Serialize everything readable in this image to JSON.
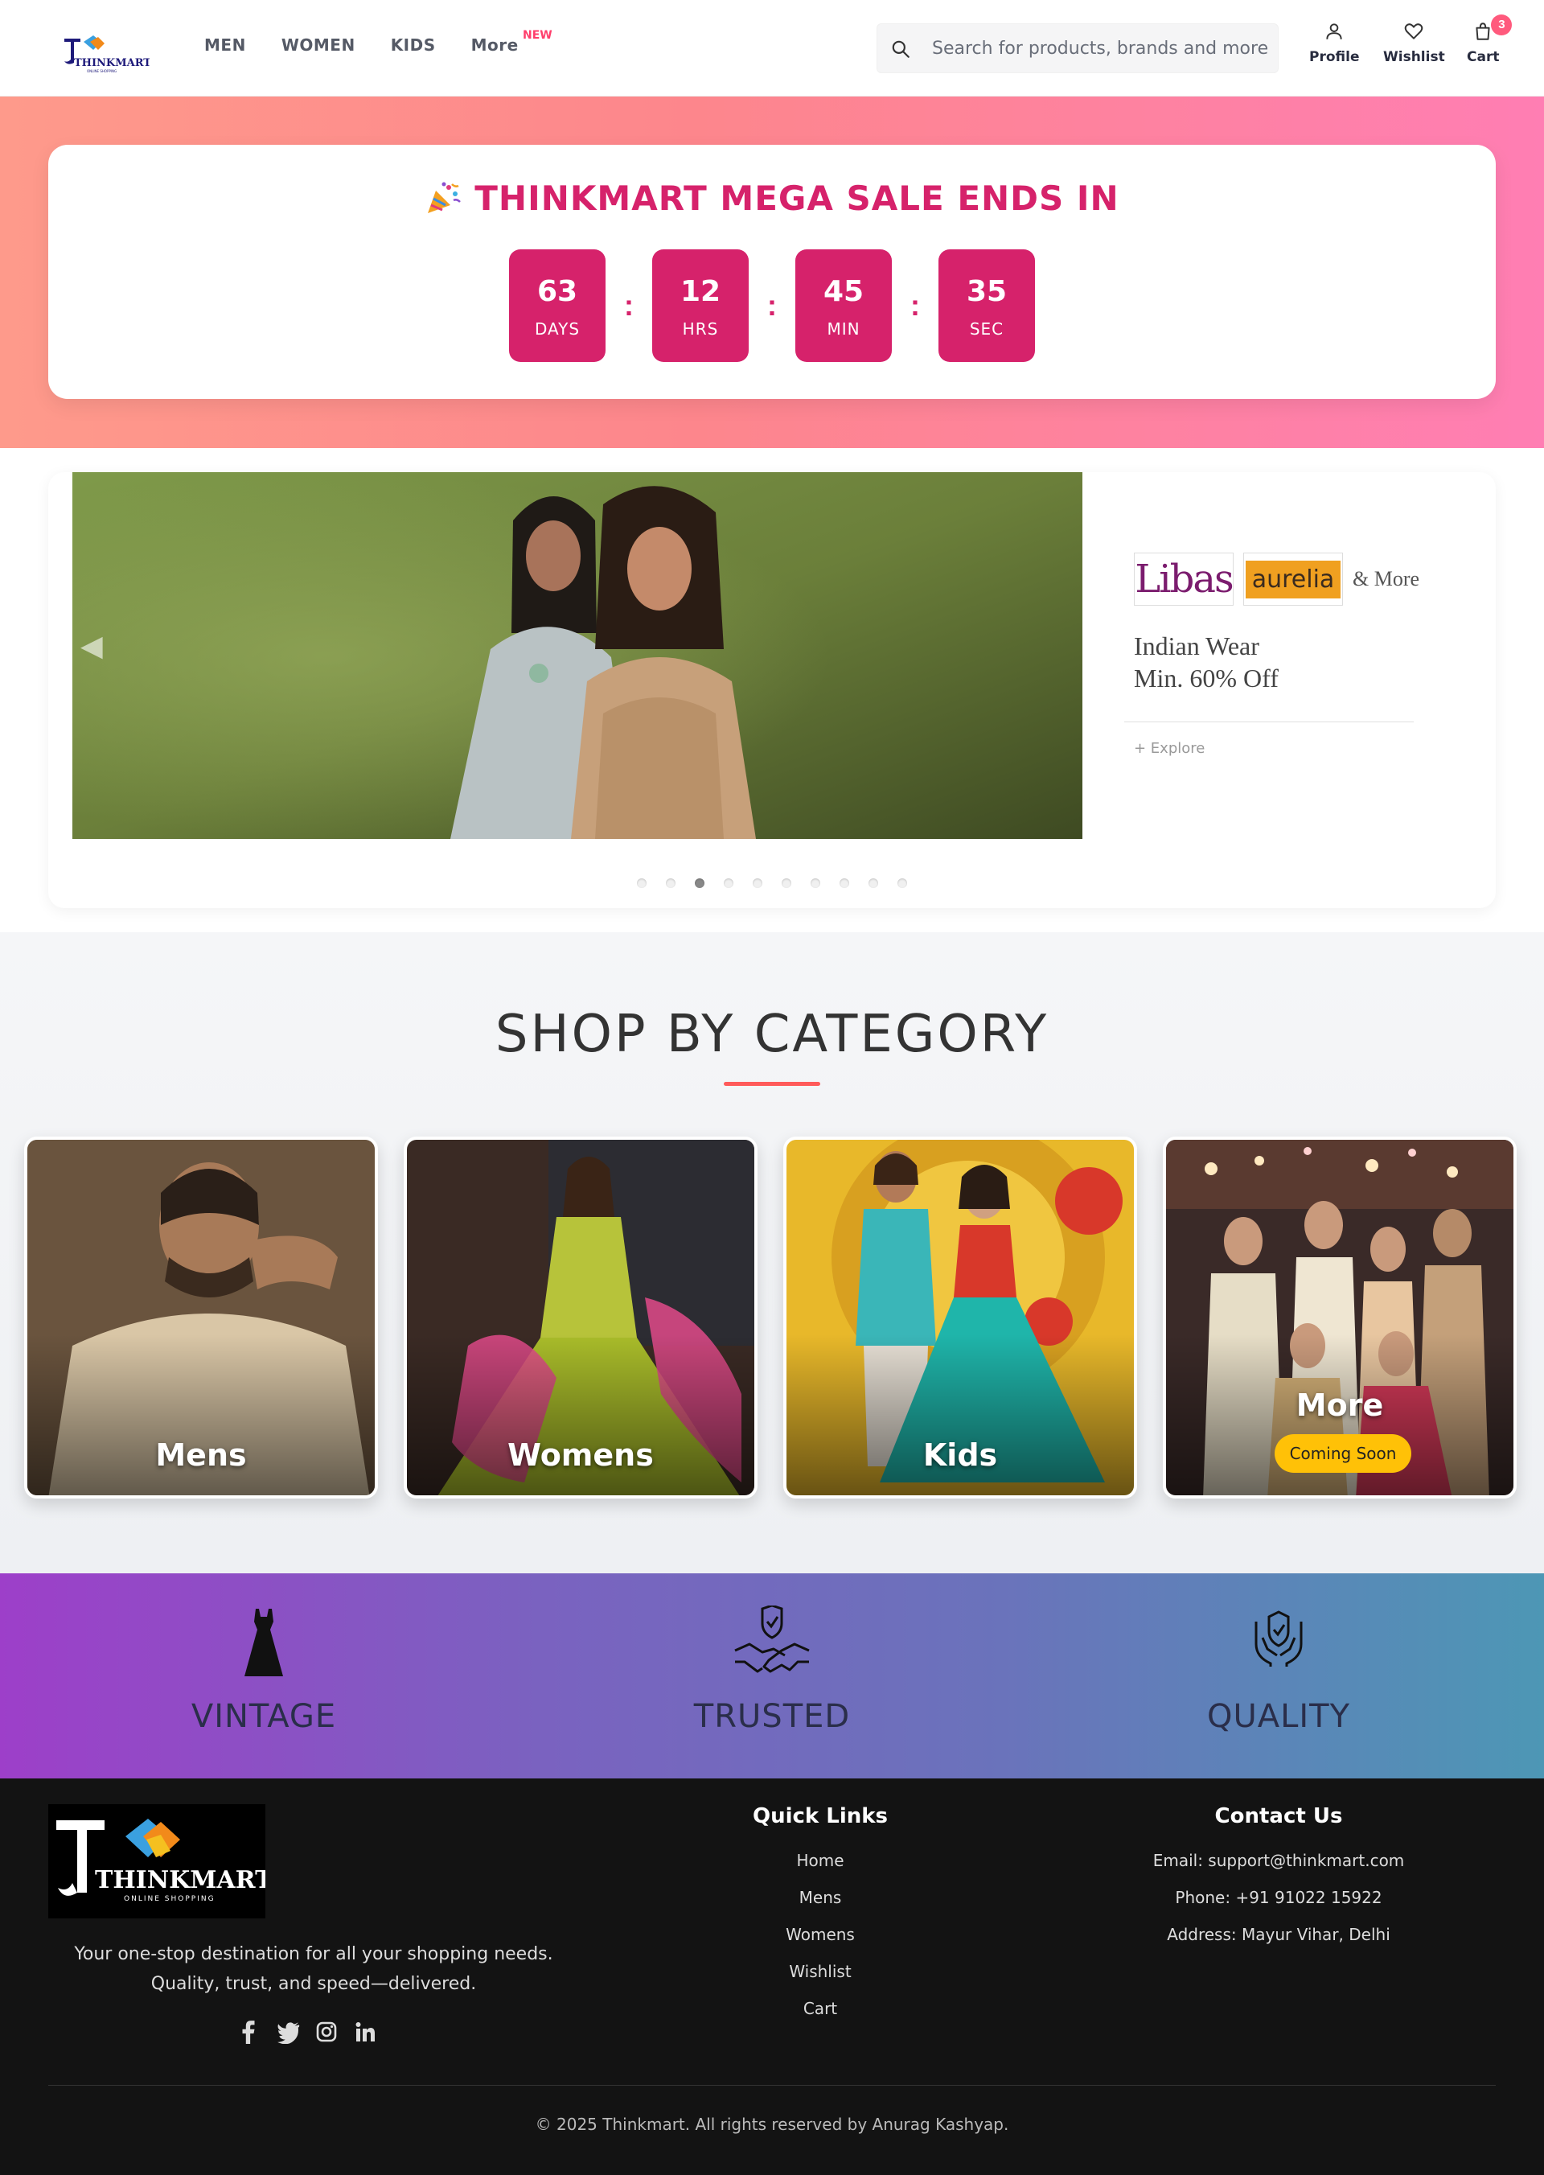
{
  "header": {
    "brand": "THINKMART",
    "brand_tagline": "ONLINE SHOPPING",
    "nav": [
      {
        "label": "MEN"
      },
      {
        "label": "WOMEN"
      },
      {
        "label": "KIDS"
      },
      {
        "label": "More",
        "badge": "NEW"
      }
    ],
    "search": {
      "placeholder": "Search for products, brands and more",
      "value": "",
      "icon": "search-icon"
    },
    "actions": [
      {
        "label": "Profile",
        "icon": "user-icon"
      },
      {
        "label": "Wishlist",
        "icon": "heart-icon"
      },
      {
        "label": "Cart",
        "icon": "bag-icon",
        "count": "3"
      }
    ]
  },
  "countdown": {
    "title": "THINKMART MEGA SALE ENDS IN",
    "icon": "party-popper-icon",
    "units": [
      {
        "value": "63",
        "unit": "DAYS"
      },
      {
        "value": "12",
        "unit": "HRS"
      },
      {
        "value": "45",
        "unit": "MIN"
      },
      {
        "value": "35",
        "unit": "SEC"
      }
    ],
    "separator": ":"
  },
  "hero": {
    "brands": {
      "first": "Libas",
      "second": "aurelia",
      "more": "& More"
    },
    "offer_line1": "Indian Wear",
    "offer_line2": "Min. 60% Off",
    "explore": "+ Explore",
    "slide_count": 10,
    "active_slide": 3
  },
  "categories": {
    "title": "SHOP BY CATEGORY",
    "items": [
      {
        "label": "Mens"
      },
      {
        "label": "Womens"
      },
      {
        "label": "Kids"
      },
      {
        "label": "More",
        "badge": "Coming Soon"
      }
    ]
  },
  "features": [
    {
      "label": "VINTAGE",
      "icon": "dress-icon"
    },
    {
      "label": "TRUSTED",
      "icon": "handshake-shield-icon"
    },
    {
      "label": "QUALITY",
      "icon": "quality-shield-icon"
    }
  ],
  "footer": {
    "description": "Your one-stop destination for all your shopping needs. Quality, trust, and speed—delivered.",
    "social": [
      "facebook-icon",
      "twitter-icon",
      "instagram-icon",
      "linkedin-icon"
    ],
    "quick_links_title": "Quick Links",
    "quick_links": [
      "Home",
      "Mens",
      "Womens",
      "Wishlist",
      "Cart"
    ],
    "contact_title": "Contact Us",
    "contact": [
      "Email: support@thinkmart.com",
      "Phone: +91 91022 15922",
      "Address: Mayur Vihar, Delhi"
    ],
    "copyright": "© 2025 Thinkmart. All rights reserved by Anurag Kashyap."
  },
  "colors": {
    "accent": "#d6226b",
    "badge": "#ff3f6c",
    "underline": "#ff5a5a",
    "coming_soon": "#ffc107",
    "footer_bg": "#131313"
  }
}
